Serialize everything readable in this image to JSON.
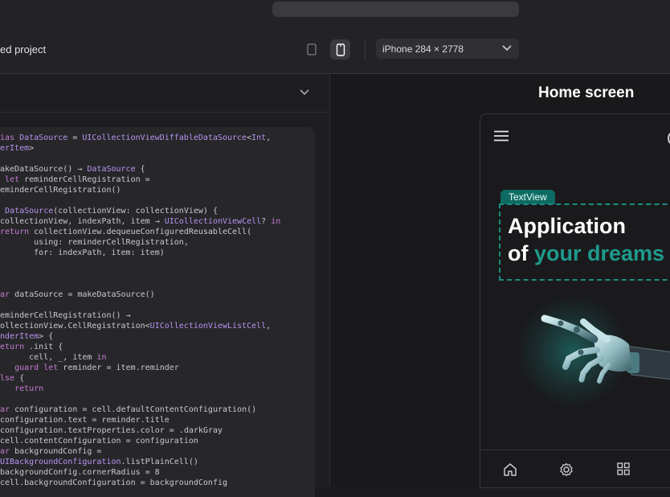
{
  "header": {
    "project_name": "ed project",
    "device_select": {
      "label": "iPhone  284 × 2778"
    }
  },
  "code": {
    "lines": [
      "ias DataSource = UICollectionViewDiffableDataSource<Int,",
      "erItem>",
      "",
      "akeDataSource() → DataSource {",
      " let reminderCellRegistration =",
      "eminderCellRegistration()",
      "",
      " DataSource(collectionView: collectionView) {",
      "collectionView, indexPath, item → UICollectionViewCell? in",
      "return collectionView.dequeueConfiguredReusableCell(",
      "       using: reminderCellRegistration,",
      "       for: indexPath, item: item)",
      "",
      "",
      "",
      "ar dataSource = makeDataSource()",
      "",
      "eminderCellRegistration() →",
      "ollectionView.CellRegistration<UICollectionViewListCell,",
      "nderItem> {",
      "eturn .init {",
      "      cell, _, item in",
      "   guard let reminder = item.reminder",
      "lse {",
      "   return",
      "",
      "ar configuration = cell.defaultContentConfiguration()",
      "configuration.text = reminder.title",
      "configuration.textProperties.color = .darkGray",
      "cell.contentConfiguration = configuration",
      "ar backgroundConfig =",
      "UIBackgroundConfiguration.listPlainCell()",
      "backgroundConfig.cornerRadius = 8",
      "cell.backgroundConfiguration = backgroundConfig"
    ]
  },
  "preview": {
    "title": "Home screen",
    "badge": "TextView",
    "headline_line1": "Application",
    "headline_line2_prefix": "of ",
    "headline_line2_accent": "your dreams"
  },
  "colors": {
    "accent": "#1f9a8c",
    "badge_bg": "#0e6b64",
    "background": "#1b1b1e"
  },
  "nav_icons": [
    "home-icon",
    "settings-icon",
    "grid-icon"
  ]
}
